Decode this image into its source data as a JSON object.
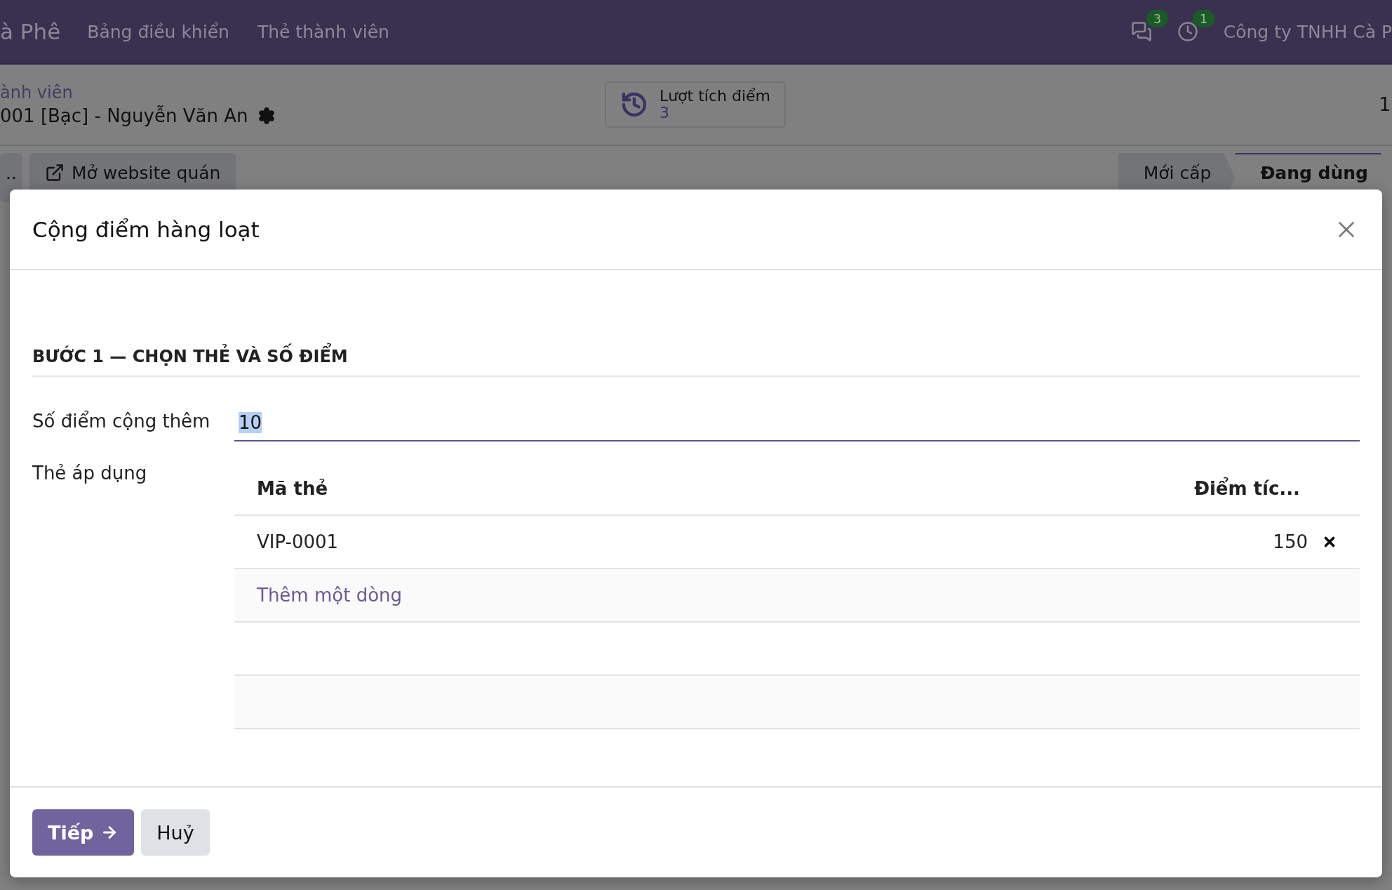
{
  "navbar": {
    "app_name": "à Phê",
    "menu": [
      "Bảng điều khiển",
      "Thẻ thành viên"
    ],
    "messages_count": "3",
    "activities_count": "1",
    "company": "Công ty TNHH Cà P"
  },
  "breadcrumb": {
    "parent": "ành viên",
    "current": "001 [Bạc] - Nguyễn Văn An"
  },
  "stat_button": {
    "label": "Lượt tích điểm",
    "value": "3"
  },
  "pager": "1",
  "action_buttons": [
    {
      "label": "..",
      "kind": "plain"
    },
    {
      "label": "Mở website quán",
      "kind": "external"
    }
  ],
  "status_steps": [
    {
      "label": "Mới cấp",
      "selected": false
    },
    {
      "label": "Đang dùng",
      "selected": true
    }
  ],
  "dialog": {
    "title": "Cộng điểm hàng loạt",
    "section": "BƯỚC 1 — CHỌN THẺ VÀ SỐ ĐIỂM",
    "points_field": {
      "label": "Số điểm cộng thêm",
      "value": "10",
      "text_selected": true
    },
    "cards_field": {
      "label": "Thẻ áp dụng",
      "columns": [
        "Mã thẻ",
        "Điểm tíc..."
      ],
      "rows": [
        {
          "code": "VIP-0001",
          "points": "150"
        }
      ],
      "add_line": "Thêm một dòng"
    },
    "buttons": [
      {
        "label": "Tiếp",
        "kind": "primary"
      },
      {
        "label": "Huỷ",
        "kind": "secondary"
      }
    ]
  }
}
